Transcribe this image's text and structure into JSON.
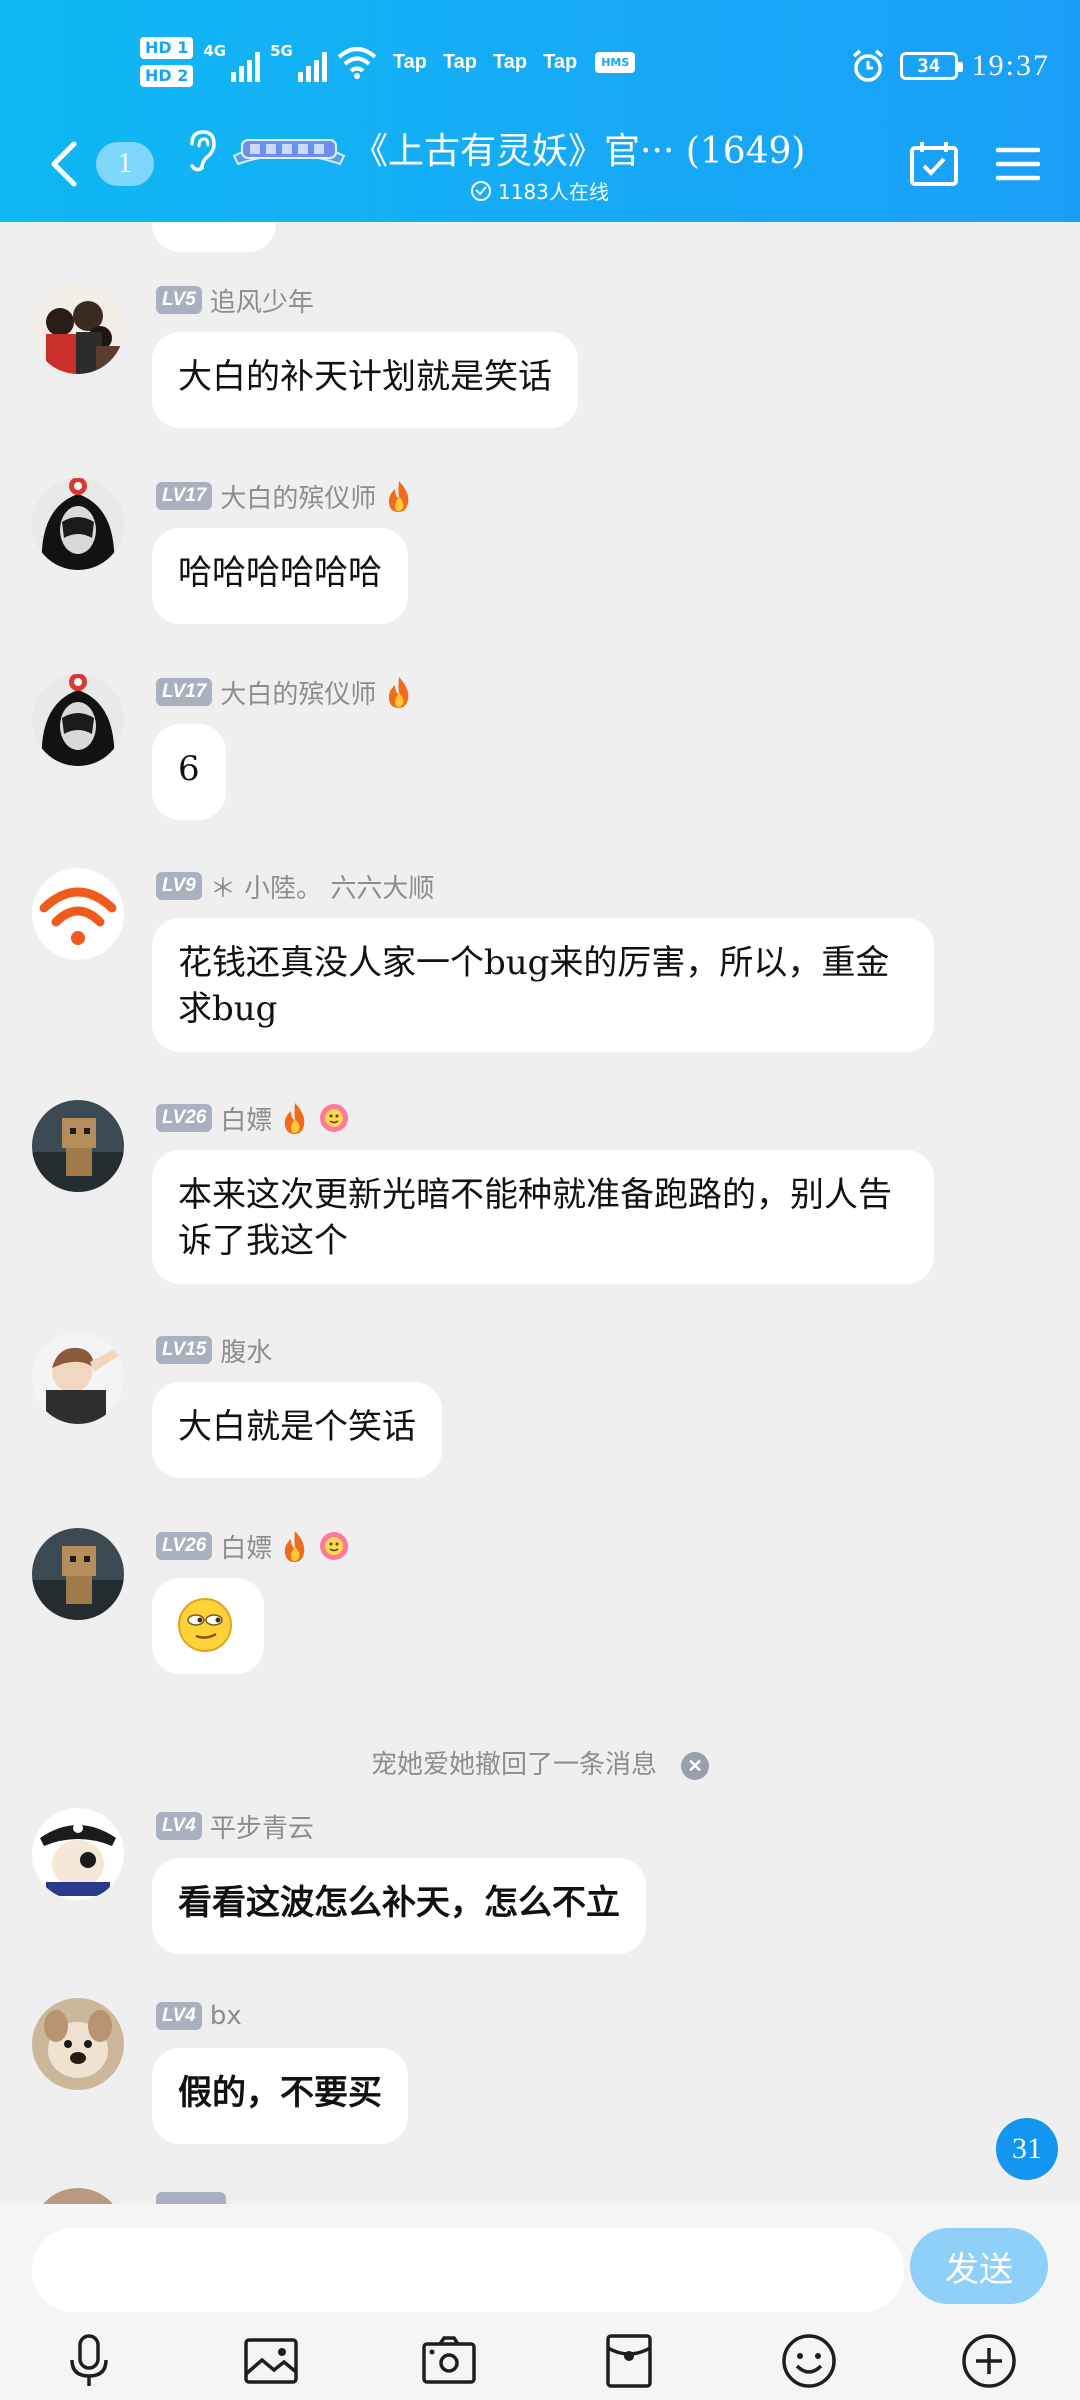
{
  "status_bar": {
    "hd1": "HD 1",
    "hd2": "HD 2",
    "net1": "4G",
    "net2": "5G",
    "taps": [
      "Tap",
      "Tap",
      "Tap",
      "Tap"
    ],
    "hms": "HMS",
    "battery": "34",
    "time": "19:37"
  },
  "header": {
    "unread": "1",
    "title": "《上古有灵妖》官··· (1649)",
    "online": "1183人在线"
  },
  "messages": [
    {
      "level": "LV5",
      "nick": "追风少年",
      "text": "大白的补天计划就是笑话"
    },
    {
      "level": "LV17",
      "nick": "大白的殡仪师",
      "text": "哈哈哈哈哈哈"
    },
    {
      "level": "LV17",
      "nick": "大白的殡仪师",
      "text": "6"
    },
    {
      "level": "LV9",
      "nick": "＊ 小陸。 六六大顺",
      "text": "花钱还真没人家一个bug来的厉害，所以，重金求bug"
    },
    {
      "level": "LV26",
      "nick": "白嫖",
      "text": "本来这次更新光暗不能种就准备跑路的，别人告诉了我这个"
    },
    {
      "level": "LV15",
      "nick": "腹水",
      "text": "大白就是个笑话"
    },
    {
      "level": "LV26",
      "nick": "白嫖",
      "text": ""
    },
    {
      "level": "LV4",
      "nick": "平步青云",
      "text": "看看这波怎么补天，怎么不立"
    },
    {
      "level": "LV4",
      "nick": "bx",
      "text": "假的，不要买"
    }
  ],
  "recall_notice": "宠她爱她撤回了一条消息",
  "new_count": "31",
  "bottom": {
    "input_placeholder": "",
    "send_label": "发送"
  },
  "colors": {
    "header": "#16aaf7",
    "bubble": "#ffffff",
    "level_badge": "#a9b1c1",
    "send": "#8fd0f8"
  }
}
